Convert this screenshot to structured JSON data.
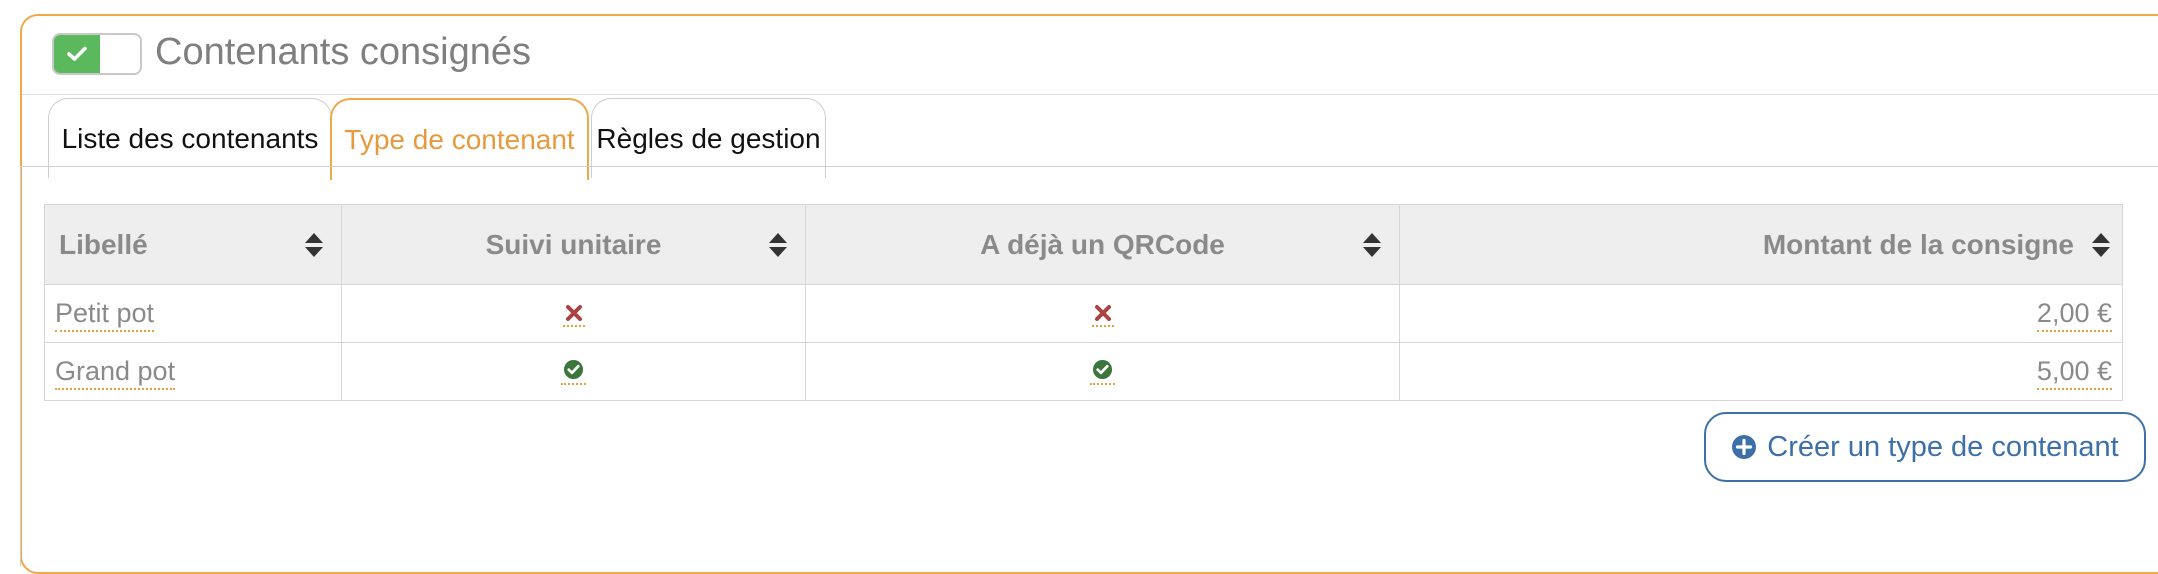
{
  "panel": {
    "title": "Contenants consignés",
    "toggle_on": true
  },
  "tabs": [
    {
      "label": "Liste des contenants",
      "active": false
    },
    {
      "label": "Type de contenant",
      "active": true
    },
    {
      "label": "Règles de gestion",
      "active": false
    }
  ],
  "table": {
    "columns": [
      "Libellé",
      "Suivi unitaire",
      "A déjà un QRCode",
      "Montant de la consigne"
    ],
    "rows": [
      {
        "libelle": "Petit pot",
        "suivi_unitaire": "cross-icon",
        "qrcode": "cross-icon",
        "montant": "2,00 €"
      },
      {
        "libelle": "Grand pot",
        "suivi_unitaire": "check-circle-icon",
        "qrcode": "check-circle-icon",
        "montant": "5,00 €"
      }
    ]
  },
  "actions": {
    "create_label": "Créer un type de contenant",
    "create_icon": "plus-circle-icon"
  },
  "colors": {
    "accent_orange": "#f0a94a",
    "toggle_green": "#5cb85c",
    "cross_red": "#a94442",
    "check_green": "#3c763d",
    "button_blue": "#3d70a8"
  }
}
